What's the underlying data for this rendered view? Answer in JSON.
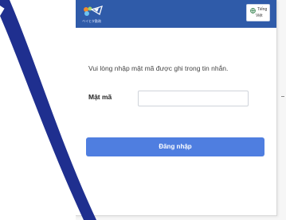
{
  "header": {
    "brand_caption": "ベイヒタ勤務",
    "language_button": {
      "line1": "Tiếng",
      "line2": "Việt",
      "icon": "globe-icon"
    }
  },
  "form": {
    "prompt": "Vui lòng nhập mật mã được ghi trong tin nhắn.",
    "password_label": "Mật mã",
    "password_value": "",
    "login_label": "Đăng nhập"
  },
  "colors": {
    "header": "#2f5ba9",
    "button": "#4f7ee0",
    "overlay_stripe": "#1f2f8f"
  }
}
